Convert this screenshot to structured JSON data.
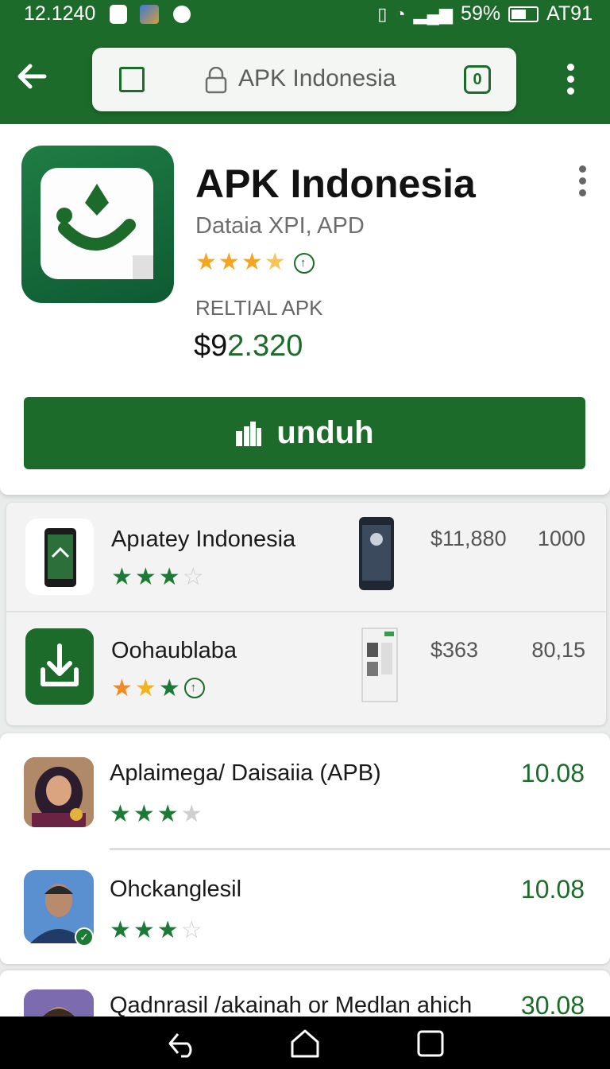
{
  "status_bar": {
    "time": "12.1240",
    "battery": "59%",
    "carrier": "AT91"
  },
  "toolbar": {
    "url_text": "APK Indonesia",
    "tab_count": "0"
  },
  "app": {
    "title": "APK Indonesia",
    "subtitle": "Dataia XPI, APD",
    "rating_stars": 3.5,
    "type_label": "RELTIAL APK",
    "price_part1": "$9",
    "price_part2": "2.320",
    "download_label": "unduh"
  },
  "list_top": [
    {
      "title": "Apıatey Indonesia",
      "price": "$11,880",
      "count": "1000",
      "stars": 3
    },
    {
      "title": "Oohaublaba",
      "price": "$363",
      "count": "80,15",
      "stars": 3
    }
  ],
  "list_people": [
    {
      "title": "Aplaimega/ Daisaiia (APB)",
      "value": "10.08",
      "stars": 3
    },
    {
      "title": "Ohckanglesil",
      "value": "10.08",
      "stars": 3
    },
    {
      "title": "Qadnrasil /akainah or Medlan ahich",
      "value": "30.08"
    }
  ],
  "colors": {
    "brand_green": "#1d6b2a",
    "star_gold": "#f4a623"
  },
  "icons": [
    "back-arrow-icon",
    "tab-square-icon",
    "lock-icon",
    "more-vert-icon",
    "thumbs-up-icon",
    "download-icon",
    "back-nav-icon",
    "home-nav-icon",
    "recents-nav-icon"
  ]
}
